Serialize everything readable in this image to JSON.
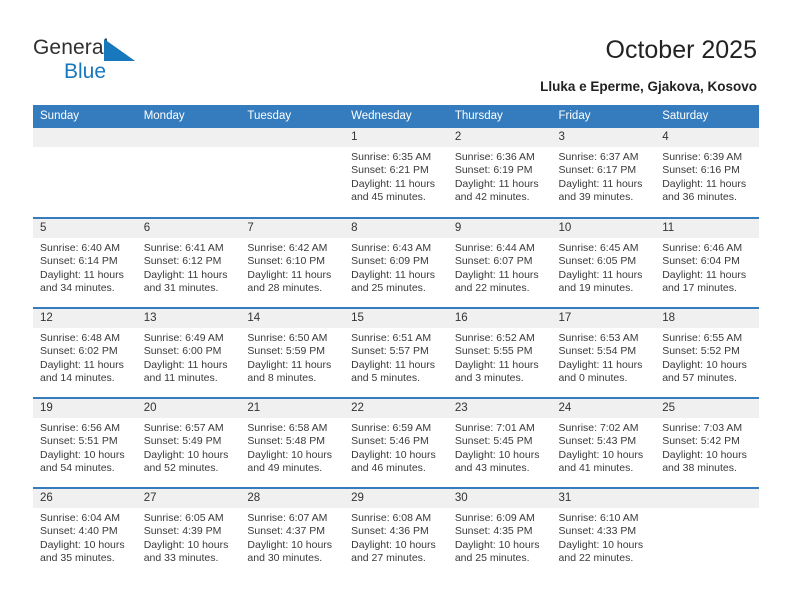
{
  "brand": {
    "name_part1": "General",
    "name_part2": "Blue",
    "triangle_icon": "blue-triangle-logo",
    "accent_color": "#1878be"
  },
  "header": {
    "title": "October 2025",
    "subtitle": "Lluka e Eperme, Gjakova, Kosovo"
  },
  "calendar": {
    "header_bg": "#357cbf",
    "daynum_bg": "#f0f0f0",
    "weekdays": [
      "Sunday",
      "Monday",
      "Tuesday",
      "Wednesday",
      "Thursday",
      "Friday",
      "Saturday"
    ],
    "labels": {
      "sunrise": "Sunrise:",
      "sunset": "Sunset:",
      "daylight": "Daylight:"
    },
    "weeks": [
      [
        {
          "day": "",
          "empty": true
        },
        {
          "day": "",
          "empty": true
        },
        {
          "day": "",
          "empty": true
        },
        {
          "day": "1",
          "sunrise": "Sunrise: 6:35 AM",
          "sunset": "Sunset: 6:21 PM",
          "daylight_line1": "Daylight: 11 hours",
          "daylight_line2": "and 45 minutes."
        },
        {
          "day": "2",
          "sunrise": "Sunrise: 6:36 AM",
          "sunset": "Sunset: 6:19 PM",
          "daylight_line1": "Daylight: 11 hours",
          "daylight_line2": "and 42 minutes."
        },
        {
          "day": "3",
          "sunrise": "Sunrise: 6:37 AM",
          "sunset": "Sunset: 6:17 PM",
          "daylight_line1": "Daylight: 11 hours",
          "daylight_line2": "and 39 minutes."
        },
        {
          "day": "4",
          "sunrise": "Sunrise: 6:39 AM",
          "sunset": "Sunset: 6:16 PM",
          "daylight_line1": "Daylight: 11 hours",
          "daylight_line2": "and 36 minutes."
        }
      ],
      [
        {
          "day": "5",
          "sunrise": "Sunrise: 6:40 AM",
          "sunset": "Sunset: 6:14 PM",
          "daylight_line1": "Daylight: 11 hours",
          "daylight_line2": "and 34 minutes."
        },
        {
          "day": "6",
          "sunrise": "Sunrise: 6:41 AM",
          "sunset": "Sunset: 6:12 PM",
          "daylight_line1": "Daylight: 11 hours",
          "daylight_line2": "and 31 minutes."
        },
        {
          "day": "7",
          "sunrise": "Sunrise: 6:42 AM",
          "sunset": "Sunset: 6:10 PM",
          "daylight_line1": "Daylight: 11 hours",
          "daylight_line2": "and 28 minutes."
        },
        {
          "day": "8",
          "sunrise": "Sunrise: 6:43 AM",
          "sunset": "Sunset: 6:09 PM",
          "daylight_line1": "Daylight: 11 hours",
          "daylight_line2": "and 25 minutes."
        },
        {
          "day": "9",
          "sunrise": "Sunrise: 6:44 AM",
          "sunset": "Sunset: 6:07 PM",
          "daylight_line1": "Daylight: 11 hours",
          "daylight_line2": "and 22 minutes."
        },
        {
          "day": "10",
          "sunrise": "Sunrise: 6:45 AM",
          "sunset": "Sunset: 6:05 PM",
          "daylight_line1": "Daylight: 11 hours",
          "daylight_line2": "and 19 minutes."
        },
        {
          "day": "11",
          "sunrise": "Sunrise: 6:46 AM",
          "sunset": "Sunset: 6:04 PM",
          "daylight_line1": "Daylight: 11 hours",
          "daylight_line2": "and 17 minutes."
        }
      ],
      [
        {
          "day": "12",
          "sunrise": "Sunrise: 6:48 AM",
          "sunset": "Sunset: 6:02 PM",
          "daylight_line1": "Daylight: 11 hours",
          "daylight_line2": "and 14 minutes."
        },
        {
          "day": "13",
          "sunrise": "Sunrise: 6:49 AM",
          "sunset": "Sunset: 6:00 PM",
          "daylight_line1": "Daylight: 11 hours",
          "daylight_line2": "and 11 minutes."
        },
        {
          "day": "14",
          "sunrise": "Sunrise: 6:50 AM",
          "sunset": "Sunset: 5:59 PM",
          "daylight_line1": "Daylight: 11 hours",
          "daylight_line2": "and 8 minutes."
        },
        {
          "day": "15",
          "sunrise": "Sunrise: 6:51 AM",
          "sunset": "Sunset: 5:57 PM",
          "daylight_line1": "Daylight: 11 hours",
          "daylight_line2": "and 5 minutes."
        },
        {
          "day": "16",
          "sunrise": "Sunrise: 6:52 AM",
          "sunset": "Sunset: 5:55 PM",
          "daylight_line1": "Daylight: 11 hours",
          "daylight_line2": "and 3 minutes."
        },
        {
          "day": "17",
          "sunrise": "Sunrise: 6:53 AM",
          "sunset": "Sunset: 5:54 PM",
          "daylight_line1": "Daylight: 11 hours",
          "daylight_line2": "and 0 minutes."
        },
        {
          "day": "18",
          "sunrise": "Sunrise: 6:55 AM",
          "sunset": "Sunset: 5:52 PM",
          "daylight_line1": "Daylight: 10 hours",
          "daylight_line2": "and 57 minutes."
        }
      ],
      [
        {
          "day": "19",
          "sunrise": "Sunrise: 6:56 AM",
          "sunset": "Sunset: 5:51 PM",
          "daylight_line1": "Daylight: 10 hours",
          "daylight_line2": "and 54 minutes."
        },
        {
          "day": "20",
          "sunrise": "Sunrise: 6:57 AM",
          "sunset": "Sunset: 5:49 PM",
          "daylight_line1": "Daylight: 10 hours",
          "daylight_line2": "and 52 minutes."
        },
        {
          "day": "21",
          "sunrise": "Sunrise: 6:58 AM",
          "sunset": "Sunset: 5:48 PM",
          "daylight_line1": "Daylight: 10 hours",
          "daylight_line2": "and 49 minutes."
        },
        {
          "day": "22",
          "sunrise": "Sunrise: 6:59 AM",
          "sunset": "Sunset: 5:46 PM",
          "daylight_line1": "Daylight: 10 hours",
          "daylight_line2": "and 46 minutes."
        },
        {
          "day": "23",
          "sunrise": "Sunrise: 7:01 AM",
          "sunset": "Sunset: 5:45 PM",
          "daylight_line1": "Daylight: 10 hours",
          "daylight_line2": "and 43 minutes."
        },
        {
          "day": "24",
          "sunrise": "Sunrise: 7:02 AM",
          "sunset": "Sunset: 5:43 PM",
          "daylight_line1": "Daylight: 10 hours",
          "daylight_line2": "and 41 minutes."
        },
        {
          "day": "25",
          "sunrise": "Sunrise: 7:03 AM",
          "sunset": "Sunset: 5:42 PM",
          "daylight_line1": "Daylight: 10 hours",
          "daylight_line2": "and 38 minutes."
        }
      ],
      [
        {
          "day": "26",
          "sunrise": "Sunrise: 6:04 AM",
          "sunset": "Sunset: 4:40 PM",
          "daylight_line1": "Daylight: 10 hours",
          "daylight_line2": "and 35 minutes."
        },
        {
          "day": "27",
          "sunrise": "Sunrise: 6:05 AM",
          "sunset": "Sunset: 4:39 PM",
          "daylight_line1": "Daylight: 10 hours",
          "daylight_line2": "and 33 minutes."
        },
        {
          "day": "28",
          "sunrise": "Sunrise: 6:07 AM",
          "sunset": "Sunset: 4:37 PM",
          "daylight_line1": "Daylight: 10 hours",
          "daylight_line2": "and 30 minutes."
        },
        {
          "day": "29",
          "sunrise": "Sunrise: 6:08 AM",
          "sunset": "Sunset: 4:36 PM",
          "daylight_line1": "Daylight: 10 hours",
          "daylight_line2": "and 27 minutes."
        },
        {
          "day": "30",
          "sunrise": "Sunrise: 6:09 AM",
          "sunset": "Sunset: 4:35 PM",
          "daylight_line1": "Daylight: 10 hours",
          "daylight_line2": "and 25 minutes."
        },
        {
          "day": "31",
          "sunrise": "Sunrise: 6:10 AM",
          "sunset": "Sunset: 4:33 PM",
          "daylight_line1": "Daylight: 10 hours",
          "daylight_line2": "and 22 minutes."
        },
        {
          "day": "",
          "empty": true
        }
      ]
    ]
  }
}
